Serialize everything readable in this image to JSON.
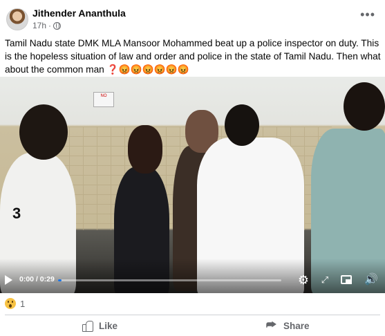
{
  "post": {
    "author": "Jithender Ananthula",
    "time": "17h",
    "more_label": "•••",
    "text": "Tamil Nadu state DMK MLA Mansoor Mohammed beat up a police inspector on duty. This is the hopeless situation of law and order and police in the state of Tamil Nadu. Then what about the common man ",
    "emojis": "❓😡😡😡😡😡😡"
  },
  "video": {
    "sign_text": "NO",
    "jersey_number": "3",
    "time_display": "0:00 / 0:29",
    "progress": 0.0
  },
  "reactions": {
    "icon": "wow-emoji",
    "count": "1"
  },
  "actions": {
    "like_label": "Like",
    "share_label": "Share"
  },
  "colors": {
    "accent": "#1b74e4",
    "secondary_text": "#65676b"
  }
}
